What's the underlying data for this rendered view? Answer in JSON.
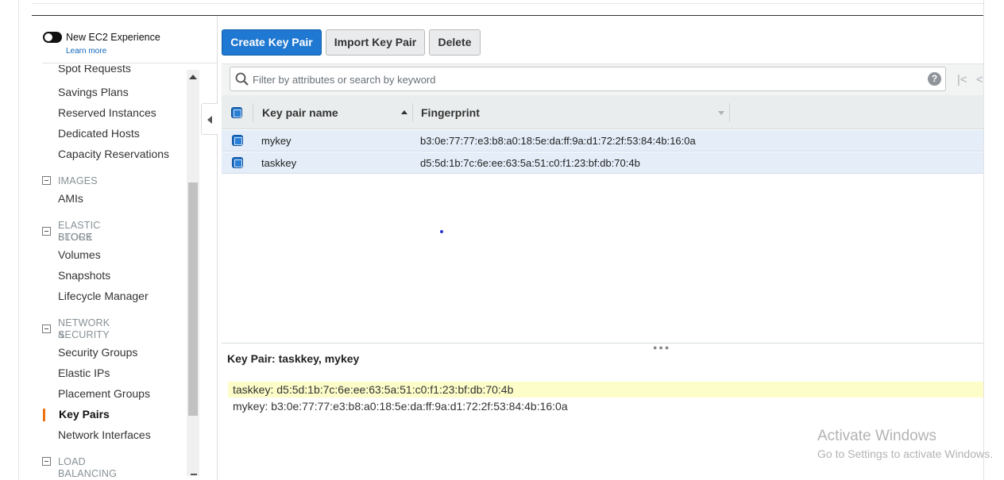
{
  "experience": {
    "toggle_label": "New EC2 Experience",
    "learn_more": "Learn more"
  },
  "sidebar": {
    "items_top": [
      {
        "label": "Spot Requests"
      },
      {
        "label": "Savings Plans"
      },
      {
        "label": "Reserved Instances"
      },
      {
        "label": "Dedicated Hosts"
      },
      {
        "label": "Capacity Reservations"
      }
    ],
    "sections": [
      {
        "title_lines": [
          "IMAGES"
        ],
        "items": [
          {
            "label": "AMIs"
          }
        ]
      },
      {
        "title_lines": [
          "ELASTIC BLOCK",
          "STORE"
        ],
        "items": [
          {
            "label": "Volumes"
          },
          {
            "label": "Snapshots"
          },
          {
            "label": "Lifecycle Manager"
          }
        ]
      },
      {
        "title_lines": [
          "NETWORK &",
          "SECURITY"
        ],
        "items": [
          {
            "label": "Security Groups"
          },
          {
            "label": "Elastic IPs"
          },
          {
            "label": "Placement Groups"
          },
          {
            "label": "Key Pairs"
          },
          {
            "label": "Network Interfaces"
          }
        ]
      },
      {
        "title_lines": [
          "LOAD BALANCING"
        ],
        "items": []
      }
    ],
    "active_item": "Key Pairs"
  },
  "toolbar": {
    "create_label": "Create Key Pair",
    "import_label": "Import Key Pair",
    "delete_label": "Delete"
  },
  "filter": {
    "placeholder": "Filter by attributes or search by keyword",
    "value": "",
    "help_label": "?",
    "first_page_label": "|<",
    "prev_page_label": "<"
  },
  "table": {
    "columns": [
      "Key pair name",
      "Fingerprint"
    ],
    "rows": [
      {
        "name": "mykey",
        "fingerprint": "b3:0e:77:77:e3:b8:a0:18:5e:da:ff:9a:d1:72:2f:53:84:4b:16:0a",
        "selected": true
      },
      {
        "name": "taskkey",
        "fingerprint": "d5:5d:1b:7c:6e:ee:63:5a:51:c0:f1:23:bf:db:70:4b",
        "selected": true
      }
    ]
  },
  "detail": {
    "title": "Key Pair: taskkey, mykey",
    "lines": [
      "taskkey: d5:5d:1b:7c:6e:ee:63:5a:51:c0:f1:23:bf:db:70:4b",
      "mykey: b3:0e:77:77:e3:b8:a0:18:5e:da:ff:9a:d1:72:2f:53:84:4b:16:0a"
    ]
  },
  "watermark": {
    "title": "Activate Windows",
    "subtitle": "Go to Settings to activate Windows."
  },
  "colors": {
    "primary_button": "#1f78d1",
    "active_accent": "#ec7211",
    "selected_row": "#e4edf8",
    "highlight": "#fdfdc9"
  }
}
